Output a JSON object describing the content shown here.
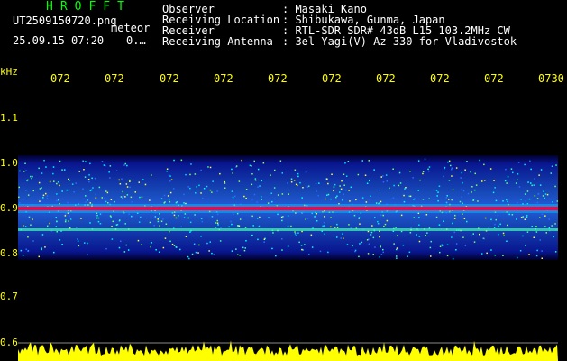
{
  "header": {
    "title": "HROFFT",
    "filename": "UT2509150720.png",
    "mode_label": "meteor",
    "datetime": "25.09.15 07:20",
    "count": "0.…"
  },
  "info": [
    {
      "key": "Observer",
      "value": ": Masaki Kano"
    },
    {
      "key": "Receiving Location",
      "value": ": Shibukawa, Gunma, Japan"
    },
    {
      "key": "Receiver",
      "value": ": RTL-SDR SDR# 43dB L15 103.2MHz CW"
    },
    {
      "key": "Receiving Antenna",
      "value": ": 3el Yagi(V) Az 330 for Vladivostok"
    }
  ],
  "axis": {
    "y_unit": "kHz",
    "y_ticks": [
      "1.1",
      "1.0",
      "0.9",
      "0.8",
      "0.7",
      "0.6"
    ],
    "x_ticks": [
      "072",
      "072",
      "072",
      "072",
      "072",
      "072",
      "072",
      "072",
      "072",
      "0730"
    ]
  },
  "colors": {
    "axis_text": "#ffff00",
    "title": "#00ff00",
    "signal_band": "#ff0040",
    "noise_low": "#0000b0",
    "noise_mid": "#00a0ff",
    "noise_high": "#00ff80",
    "amplitude_trace": "#ffff00"
  },
  "chart_data": {
    "type": "heatmap",
    "xlabel": "",
    "ylabel": "kHz",
    "ylim": [
      0.6,
      1.15
    ],
    "time_ticks": [
      "072",
      "072",
      "072",
      "072",
      "072",
      "072",
      "072",
      "072",
      "072",
      "0730"
    ],
    "noise_band_khz": [
      0.79,
      1.02
    ],
    "strong_carrier_khz": 0.9,
    "secondary_line_khz": 0.85,
    "amplitude_trace": "yellow noise trace along bottom"
  }
}
